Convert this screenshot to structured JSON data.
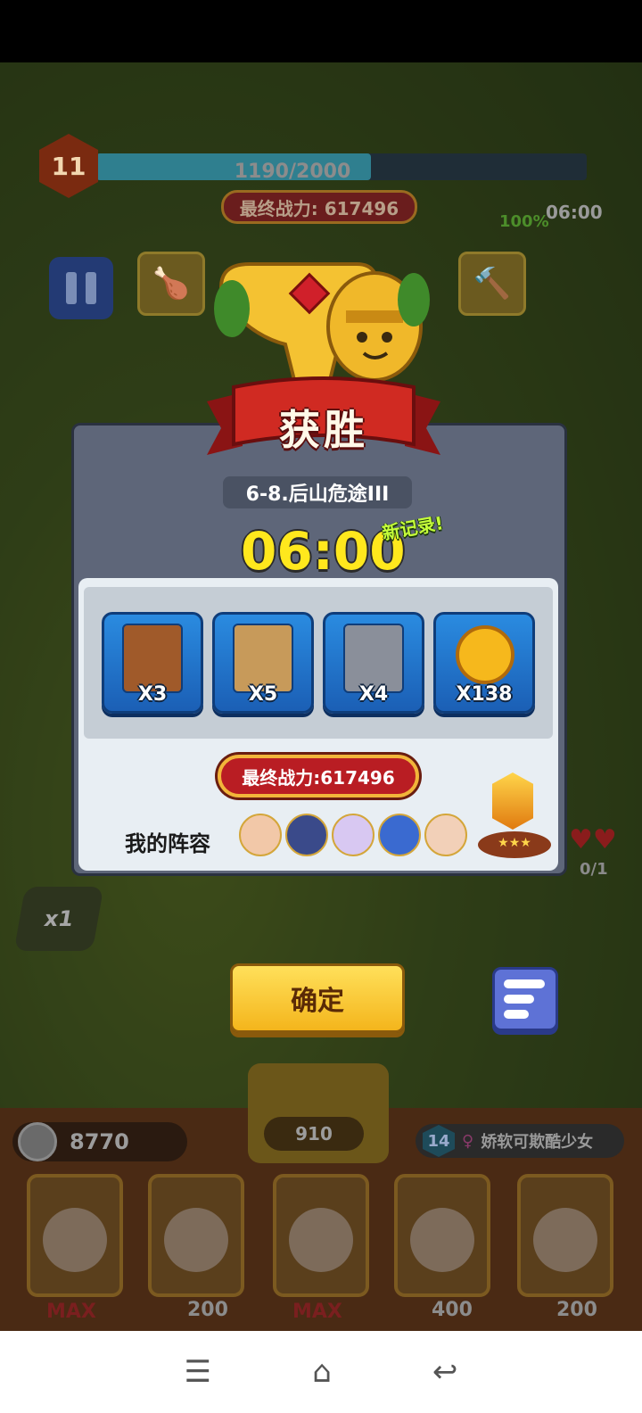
{
  "hud": {
    "level": "11",
    "xp_text": "1190/2000",
    "xp_fraction": 0.56,
    "top_power": "最终战力: 617496",
    "timer": "06:00",
    "percent": "100%",
    "speed": "x1",
    "counter": "0/1"
  },
  "victory": {
    "title": "获胜",
    "stage": "6-8.后山危途III",
    "time": "06:00",
    "new_record": "新记录!",
    "rewards": [
      {
        "icon": "bear-hero-card",
        "qty": "X3"
      },
      {
        "icon": "pot-hero-card",
        "qty": "X5"
      },
      {
        "icon": "knight-hero-card",
        "qty": "X4"
      },
      {
        "icon": "gold-coin",
        "qty": "X138"
      }
    ],
    "final_power": "最终战力:617496",
    "lineup_label": "我的阵容",
    "confirm": "确定"
  },
  "dock": {
    "coins": "8770",
    "summon_cost": "910",
    "synergy_level": "14",
    "synergy_name": "娇软可欺酷少女",
    "heroes": [
      {
        "cost": "MAX"
      },
      {
        "cost": "200"
      },
      {
        "cost": "MAX"
      },
      {
        "cost": "400"
      },
      {
        "cost": "200"
      }
    ]
  },
  "colors": {
    "panel": "#5e6679",
    "timer_yellow": "#ffe81d",
    "record_green": "#c6ff3a",
    "confirm_yellow": "#f4b51c",
    "stats_blue": "#5e72d6",
    "reward_blue": "#2a8be0"
  }
}
